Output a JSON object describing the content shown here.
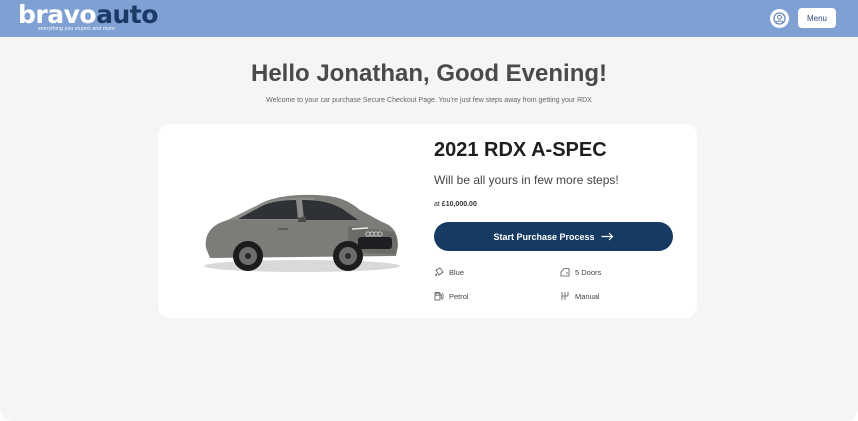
{
  "brand": {
    "name_part1": "bravo",
    "name_part2": "auto",
    "tagline": "everything you expect and more",
    "header_color": "#7fa0d2",
    "accent_dark": "#163a61"
  },
  "header": {
    "user_icon": "user-circle-icon",
    "menu_label": "Menu"
  },
  "hero": {
    "greeting": "Hello Jonathan, Good Evening!",
    "welcome": "Welcome to your car purchase Secure Checkout Page. You're just few steps away from getting your RDX"
  },
  "vehicle": {
    "model": "2021 RDX A-SPEC",
    "subtitle": "Will be all yours in few more steps!",
    "price_prefix": "at ",
    "price": "£10,000.00",
    "cta_label": "Start Purchase Process",
    "cta_icon": "arrow-right-icon",
    "features": [
      {
        "icon": "paint-bucket-icon",
        "label": "Blue"
      },
      {
        "icon": "car-door-icon",
        "label": "5 Doors"
      },
      {
        "icon": "fuel-pump-icon",
        "label": "Petrol"
      },
      {
        "icon": "gear-shift-icon",
        "label": "Manual"
      }
    ]
  }
}
